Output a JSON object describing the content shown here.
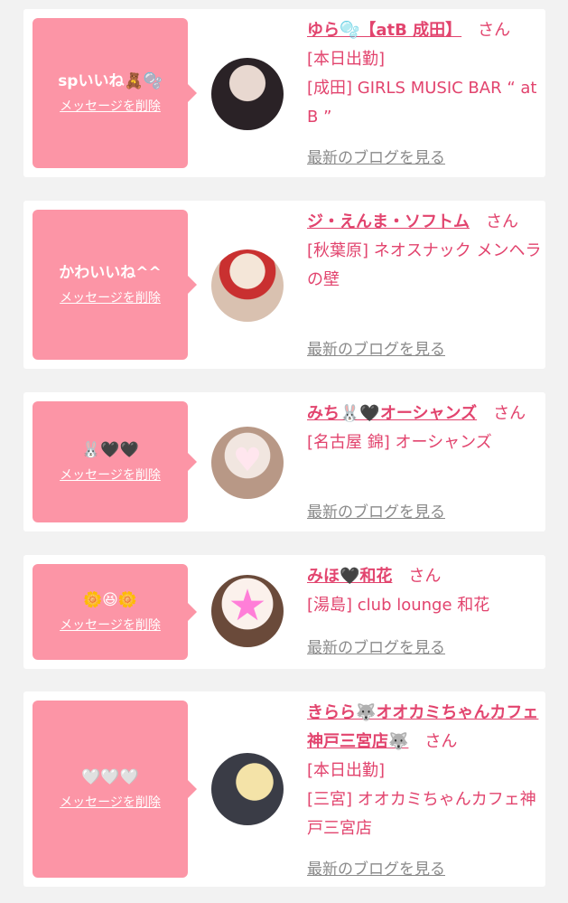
{
  "delete_label": "メッセージを削除",
  "blog_label": "最新のブログを見る",
  "san_label": "さん",
  "cards": [
    {
      "message": "spいいね🧸🫧",
      "name": "ゆら🫧【atB 成田】",
      "lines": [
        "[本日出勤]",
        "[成田] GIRLS MUSIC BAR “ at B ”"
      ]
    },
    {
      "message": "かわいいね^^",
      "name": "ジ・えんま・ソフトム",
      "lines": [
        "[秋葉原] ネオスナック メンヘラの壁"
      ]
    },
    {
      "message": "🐰🖤🖤",
      "name": "みち🐰🖤オーシャンズ",
      "lines": [
        "[名古屋 錦] オーシャンズ"
      ]
    },
    {
      "message": "🌼😆🌼",
      "name": "みほ🖤和花",
      "lines": [
        "[湯島] club lounge 和花"
      ]
    },
    {
      "message": "🤍🤍🤍",
      "name": "きらら🐺オオカミちゃんカフェ神戸三宮店🐺",
      "lines": [
        "[本日出勤]",
        "[三宮] オオカミちゃんカフェ神戸三宮店"
      ]
    }
  ]
}
